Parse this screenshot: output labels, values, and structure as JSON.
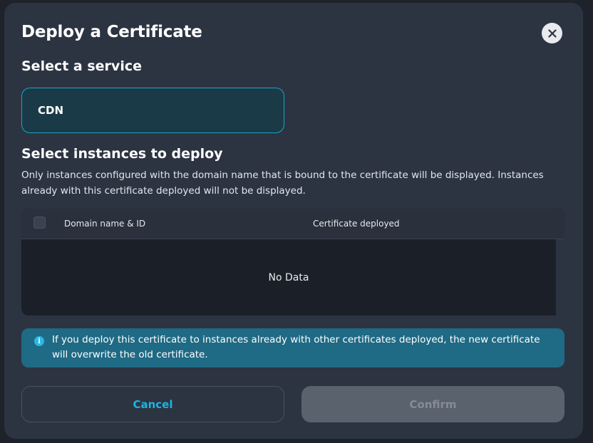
{
  "dialog": {
    "title": "Deploy a Certificate",
    "close_icon": "close-icon"
  },
  "service_section": {
    "heading": "Select a service",
    "selected_service": "CDN"
  },
  "instances_section": {
    "heading": "Select instances to deploy",
    "description": "Only instances configured with the domain name that is bound to the certificate will be displayed. Instances already with this certificate deployed will not be displayed."
  },
  "table": {
    "columns": [
      "Domain name & ID",
      "Certificate deployed"
    ],
    "empty_text": "No Data"
  },
  "notice": {
    "icon": "info-icon",
    "text": "If you deploy this certificate to instances already with other certificates deployed, the new certificate will overwrite the old certificate."
  },
  "footer": {
    "cancel_label": "Cancel",
    "confirm_label": "Confirm"
  },
  "colors": {
    "modal_bg": "#2c3442",
    "accent": "#1fb3e0",
    "notice_bg": "#1f6a85",
    "selected_border": "#1ba3c9"
  }
}
